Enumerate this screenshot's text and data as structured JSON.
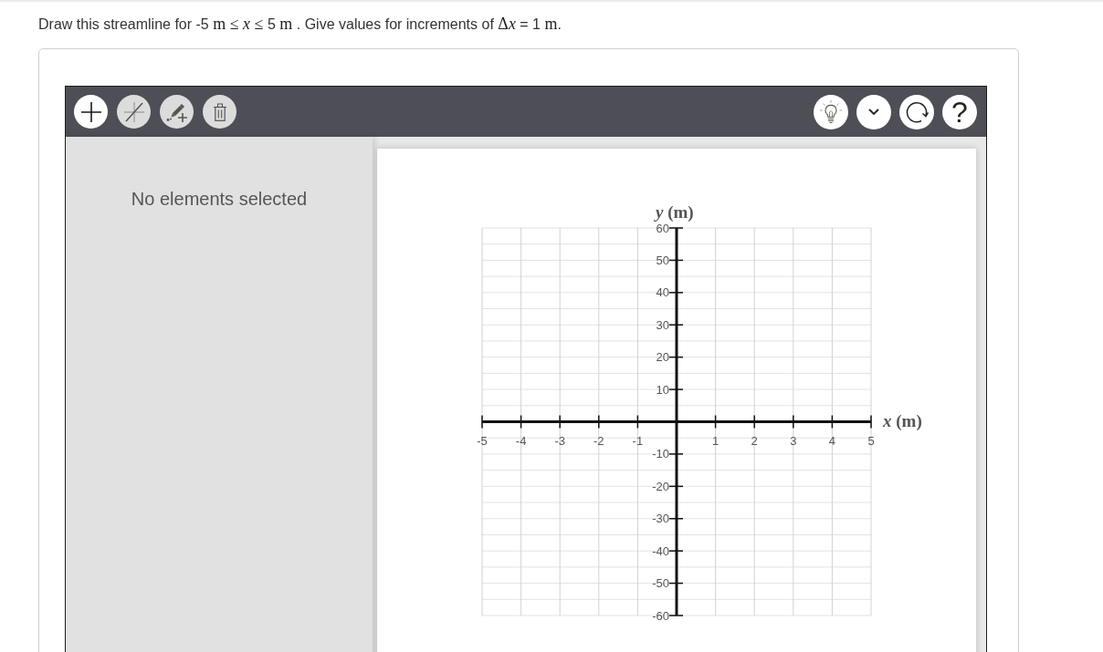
{
  "question": [
    {
      "kind": "text",
      "text": "Draw this streamline for -5 "
    },
    {
      "kind": "math",
      "text": "m ≤ *x* ≤ "
    },
    {
      "kind": "text",
      "text": "5 "
    },
    {
      "kind": "math",
      "text": "m"
    },
    {
      "kind": "text",
      "text": " . Give values for increments of "
    },
    {
      "kind": "math",
      "text": "Δ"
    },
    {
      "kind": "math",
      "text": "*x*"
    },
    {
      "kind": "text",
      "text": " = 1 "
    },
    {
      "kind": "math",
      "text": "m"
    },
    {
      "kind": "text",
      "text": "."
    }
  ],
  "toolbar": {
    "left_tools": [
      {
        "kind": "add",
        "disabled": false
      },
      {
        "kind": "line",
        "disabled": true
      },
      {
        "kind": "draw",
        "disabled": true
      },
      {
        "kind": "delete",
        "disabled": true
      }
    ],
    "right_tools": [
      {
        "kind": "hint"
      },
      {
        "kind": "menu"
      },
      {
        "kind": "redo"
      },
      {
        "kind": "help",
        "label": "?"
      }
    ]
  },
  "properties_panel": {
    "message": "No elements selected"
  },
  "graph": {
    "chart_data": {
      "type": "line",
      "xlabel": "*x* (m)",
      "ylabel": "*y* (m)",
      "xlim": [
        -5,
        5
      ],
      "ylim": [
        -60,
        60
      ],
      "xticks": [
        -5,
        -4,
        -3,
        -2,
        -1,
        1,
        2,
        3,
        4,
        5
      ],
      "yticks": [
        -60,
        -50,
        -40,
        -30,
        -20,
        -10,
        10,
        20,
        30,
        40,
        50,
        60
      ],
      "grid": true
    }
  }
}
